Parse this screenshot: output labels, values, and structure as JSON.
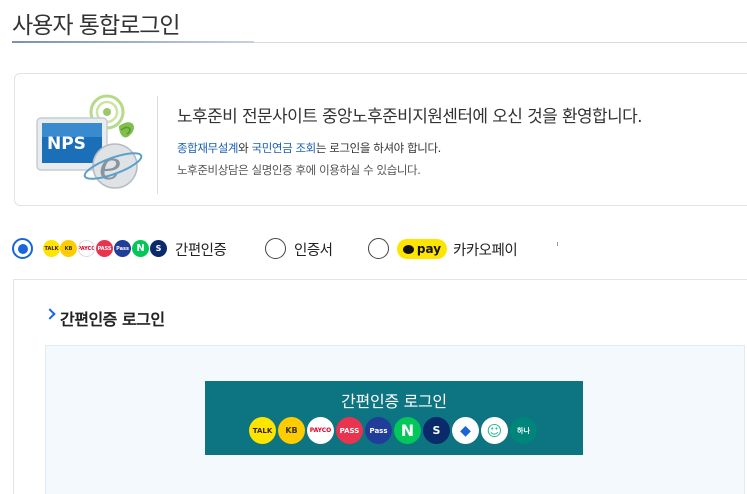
{
  "page": {
    "title": "사용자 통합로그인"
  },
  "intro": {
    "logo_text": "NPS",
    "main_text": "노후준비 전문사이트 중앙노후준비지원센터에 오신 것을 환영합니다.",
    "sub_text_highlight": "종합재무설계",
    "sub_text_mid": "와 ",
    "sub_text_highlight2": "국민연금 조회",
    "sub_text_rest": "는 로그인을 하셔야 합니다.",
    "sub_text2": "노후준비상담은 실명인증 후에 이용하실 수 있습니다."
  },
  "auth_methods": [
    {
      "label": "간편인증",
      "selected": true
    },
    {
      "label": "인증서",
      "selected": false
    },
    {
      "label": "카카오페이",
      "selected": false
    }
  ],
  "kakaopay_badge": "pay",
  "mini_icons": [
    {
      "name": "kakaotalk-icon",
      "text": "TALK",
      "bg": "#fde500",
      "fg": "#3b1e1e"
    },
    {
      "name": "kb-icon",
      "text": "KB",
      "bg": "#ffcc00",
      "fg": "#333"
    },
    {
      "name": "payco-icon",
      "text": "PAYCO",
      "bg": "#ffffff",
      "fg": "#e4002b"
    },
    {
      "name": "pass-icon",
      "text": "PASS",
      "bg": "#e8344e",
      "fg": "#ffffff"
    },
    {
      "name": "samsung-pass-icon",
      "text": "Pass",
      "bg": "#1f3d99",
      "fg": "#ffffff"
    },
    {
      "name": "naver-icon",
      "text": "N",
      "bg": "#03c75a",
      "fg": "#ffffff"
    },
    {
      "name": "shinhan-icon",
      "text": "S",
      "bg": "#0a2a6b",
      "fg": "#ffffff"
    }
  ],
  "login_section": {
    "title": "간편인증 로그인",
    "button_label": "간편인증 로그인",
    "button_color": "#0d7481"
  },
  "big_icons": [
    {
      "name": "kakaotalk-icon",
      "text": "TALK",
      "bg": "#fde500",
      "fg": "#3b1e1e"
    },
    {
      "name": "kb-icon",
      "text": "KB",
      "bg": "#ffcc00",
      "fg": "#333"
    },
    {
      "name": "payco-icon",
      "text": "PAYCO",
      "bg": "#ffffff",
      "fg": "#e4002b"
    },
    {
      "name": "pass-icon",
      "text": "PASS",
      "bg": "#e8344e",
      "fg": "#ffffff"
    },
    {
      "name": "samsung-pass-icon",
      "text": "Pass",
      "bg": "#1f3d99",
      "fg": "#ffffff"
    },
    {
      "name": "naver-icon",
      "text": "N",
      "bg": "#03c75a",
      "fg": "#ffffff"
    },
    {
      "name": "shinhan-icon",
      "text": "S",
      "bg": "#0a2a6b",
      "fg": "#ffffff"
    },
    {
      "name": "toss-icon",
      "text": "◆",
      "bg": "#ffffff",
      "fg": "#1b64da"
    },
    {
      "name": "hana-icon",
      "text": "☺",
      "bg": "#ffffff",
      "fg": "#1fb98f"
    },
    {
      "name": "hana-bank-icon",
      "text": "하나",
      "bg": "#00857a",
      "fg": "#ffffff"
    }
  ]
}
